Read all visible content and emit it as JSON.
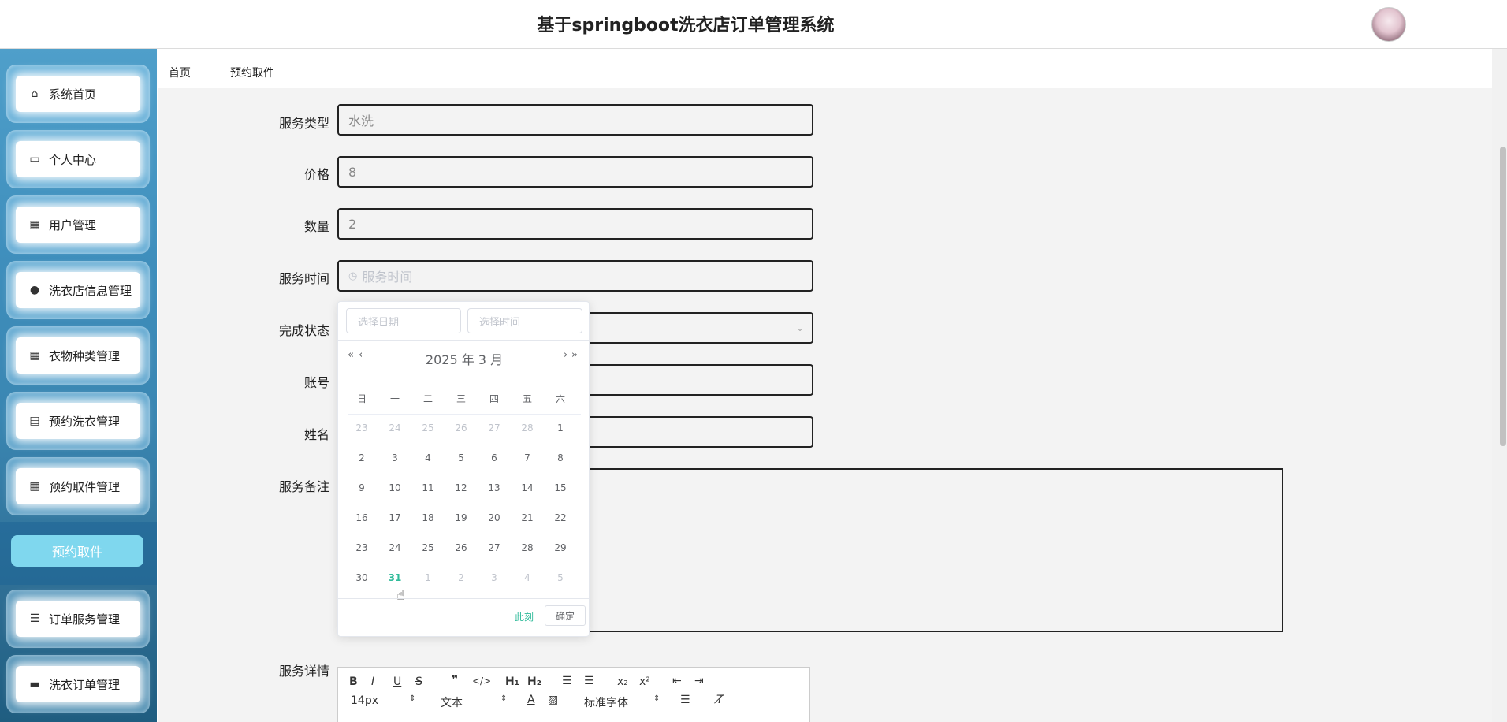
{
  "header": {
    "title": "基于springboot洗衣店订单管理系统"
  },
  "sidebar": {
    "items": [
      {
        "label": "系统首页",
        "icon": "home-icon"
      },
      {
        "label": "个人中心",
        "icon": "card-icon"
      },
      {
        "label": "用户管理",
        "icon": "grid-icon"
      },
      {
        "label": "洗衣店信息管理",
        "icon": "user-icon"
      },
      {
        "label": "衣物种类管理",
        "icon": "apps-icon"
      },
      {
        "label": "预约洗衣管理",
        "icon": "clipboard-icon"
      },
      {
        "label": "预约取件管理",
        "icon": "grid-icon"
      },
      {
        "label": "订单服务管理",
        "icon": "list-icon"
      },
      {
        "label": "洗衣订单管理",
        "icon": "printer-icon"
      }
    ],
    "active_sub": "预约取件"
  },
  "breadcrumb": {
    "home": "首页",
    "current": "预约取件"
  },
  "form": {
    "service_type": {
      "label": "服务类型",
      "value": "水洗"
    },
    "price": {
      "label": "价格",
      "value": "8"
    },
    "quantity": {
      "label": "数量",
      "value": "2"
    },
    "service_time": {
      "label": "服务时间",
      "placeholder": "服务时间"
    },
    "status": {
      "label": "完成状态"
    },
    "account": {
      "label": "账号"
    },
    "name": {
      "label": "姓名"
    },
    "remark": {
      "label": "服务备注"
    },
    "detail": {
      "label": "服务详情"
    }
  },
  "datepicker": {
    "date_placeholder": "选择日期",
    "time_placeholder": "选择时间",
    "year_month": "2025 年  3 月",
    "weekdays": [
      "日",
      "一",
      "二",
      "三",
      "四",
      "五",
      "六"
    ],
    "weeks": [
      [
        "23",
        "24",
        "25",
        "26",
        "27",
        "28",
        "1"
      ],
      [
        "2",
        "3",
        "4",
        "5",
        "6",
        "7",
        "8"
      ],
      [
        "9",
        "10",
        "11",
        "12",
        "13",
        "14",
        "15"
      ],
      [
        "16",
        "17",
        "18",
        "19",
        "20",
        "21",
        "22"
      ],
      [
        "23",
        "24",
        "25",
        "26",
        "27",
        "28",
        "29"
      ],
      [
        "30",
        "31",
        "1",
        "2",
        "3",
        "4",
        "5"
      ]
    ],
    "now_label": "此刻",
    "confirm_label": "确定"
  },
  "editor": {
    "font_size": "14px",
    "paragraph": "文本",
    "font_family": "标准字体"
  },
  "colors": {
    "accent": "#30bb9a",
    "sidebar": "#3f8fbd",
    "active_sub": "#7fd7ee"
  }
}
